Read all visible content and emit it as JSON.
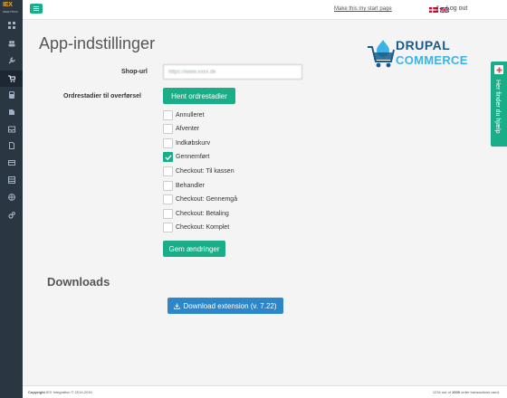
{
  "sidebar": {
    "logo_main": "IEX",
    "logo_sub": "ANALYTICS",
    "items": [
      {
        "icon": "dashboard-icon"
      },
      {
        "icon": "users-icon"
      },
      {
        "icon": "wrench-icon"
      },
      {
        "icon": "cart-icon"
      },
      {
        "icon": "calculator-icon"
      },
      {
        "icon": "book-icon"
      },
      {
        "icon": "inbox-icon"
      },
      {
        "icon": "document-icon"
      },
      {
        "icon": "credit-card-icon"
      },
      {
        "icon": "table-icon"
      },
      {
        "icon": "globe-icon"
      },
      {
        "icon": "cogs-icon"
      }
    ]
  },
  "topbar": {
    "start_page_link": "Make this my start page",
    "logout_label": "Log out"
  },
  "page": {
    "title": "App-indstillinger",
    "brand_line1": "DRUPAL",
    "brand_line2": "COMMERCE"
  },
  "form": {
    "shop_url_label": "Shop-url",
    "shop_url_value": "https://www.xxxx.dk",
    "order_states_label": "Ordrestadier til overførsel",
    "fetch_button": "Hent ordrestadier",
    "states": [
      {
        "label": "Annulleret",
        "checked": false
      },
      {
        "label": "Afventer",
        "checked": false
      },
      {
        "label": "Indkøbskurv",
        "checked": false
      },
      {
        "label": "Gennemført",
        "checked": true
      },
      {
        "label": "Checkout: Til kassen",
        "checked": false
      },
      {
        "label": "Behandler",
        "checked": false
      },
      {
        "label": "Checkout: Gennemgå",
        "checked": false
      },
      {
        "label": "Checkout: Betaling",
        "checked": false
      },
      {
        "label": "Checkout: Komplet",
        "checked": false
      }
    ],
    "save_button": "Gem ændringer"
  },
  "downloads": {
    "title": "Downloads",
    "button": "Download extension (v. 7.22)"
  },
  "help": {
    "label": "Her finder du hjælp"
  },
  "footer": {
    "copyright_bold": "Copyright",
    "copyright_rest": "IEX Integration © 2014-2016",
    "usage_count": "1234",
    "usage_mid": "out of",
    "usage_limit": "1000",
    "usage_rest": "order transactions used."
  },
  "colors": {
    "accent_green": "#1aae88",
    "accent_blue": "#2c86c9",
    "sidebar_bg": "#2b3643"
  }
}
